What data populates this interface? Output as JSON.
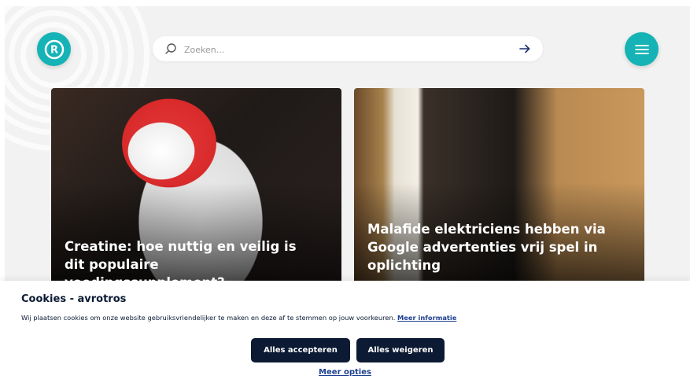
{
  "header": {
    "logo_letter": "R",
    "search": {
      "placeholder": "Zoeken..."
    }
  },
  "articles": [
    {
      "title": "Creatine: hoe nuttig en veilig is dit populaire voedingssupplement?"
    },
    {
      "title": "Malafide elektriciens hebben via Google advertenties vrij spel in oplichting"
    }
  ],
  "cookie_banner": {
    "title": "Cookies - avrotros",
    "text": "Wij plaatsen cookies om onze website gebruiksvriendelijker te maken en deze af te stemmen op jouw voorkeuren.",
    "more_info_link": "Meer informatie",
    "accept_label": "Alles accepteren",
    "reject_label": "Alles weigeren",
    "more_options_link": "Meer opties"
  },
  "colors": {
    "brand_teal": "#15b3b5",
    "dark_navy": "#0c1a33",
    "link_blue": "#1d3f8f"
  },
  "icons": [
    "search-icon",
    "arrow-right-icon",
    "hamburger-menu-icon",
    "logo-icon"
  ]
}
